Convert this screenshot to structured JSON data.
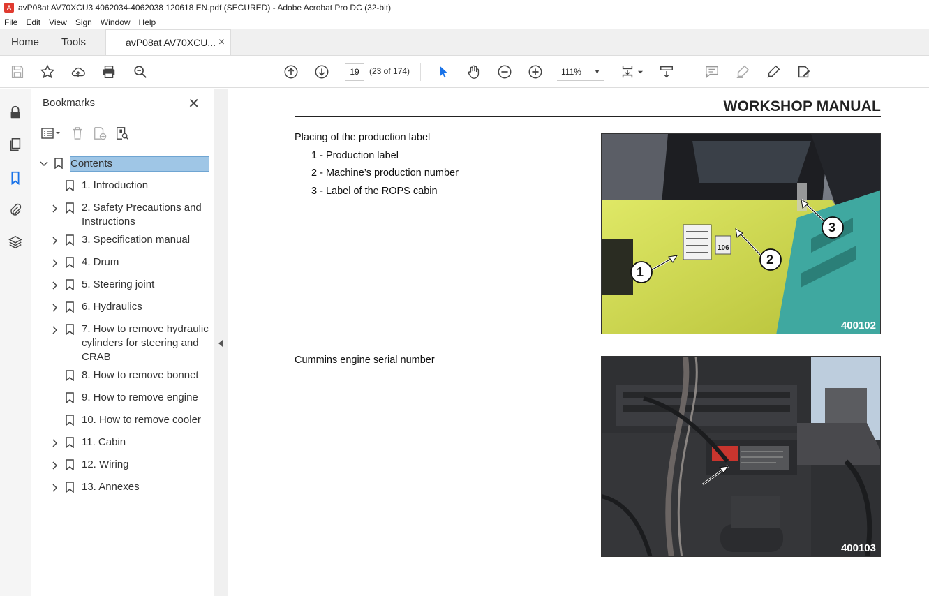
{
  "window": {
    "title": "avP08at AV70XCU3 4062034-4062038 120618 EN.pdf (SECURED) - Adobe Acrobat Pro DC (32-bit)"
  },
  "menu": [
    "File",
    "Edit",
    "View",
    "Sign",
    "Window",
    "Help"
  ],
  "tabs": {
    "home": "Home",
    "tools": "Tools",
    "document": "avP08at AV70XCU...",
    "close_glyph": "×"
  },
  "toolbar": {
    "page_number": "19",
    "page_count": "(23 of 174)",
    "zoom": "111%"
  },
  "bookmarks": {
    "title": "Bookmarks",
    "items": [
      {
        "label": "Contents",
        "expandable": true,
        "expanded": true,
        "selected": true
      },
      {
        "label": "1. Introduction",
        "expandable": false
      },
      {
        "label": "2. Safety Precautions and Instructions",
        "expandable": true
      },
      {
        "label": "3. Specification manual",
        "expandable": true
      },
      {
        "label": "4. Drum",
        "expandable": true
      },
      {
        "label": "5. Steering joint",
        "expandable": true
      },
      {
        "label": "6. Hydraulics",
        "expandable": true
      },
      {
        "label": "7. How to remove hydraulic cylinders for steering and CRAB",
        "expandable": true
      },
      {
        "label": "8. How to remove bonnet",
        "expandable": false
      },
      {
        "label": "9. How to remove engine",
        "expandable": false
      },
      {
        "label": "10. How to remove cooler",
        "expandable": false
      },
      {
        "label": "11. Cabin",
        "expandable": true
      },
      {
        "label": "12. Wiring",
        "expandable": true
      },
      {
        "label": "13. Annexes",
        "expandable": true
      }
    ]
  },
  "document": {
    "header": "WORKSHOP MANUAL",
    "section1": {
      "heading": "Placing of the production label",
      "items": [
        "1 - Production label",
        "2 - Machine’s production number",
        "3 - Label of the ROPS cabin"
      ],
      "photo_code": "400102",
      "callouts": [
        "1",
        "2",
        "3"
      ]
    },
    "section2": {
      "heading": "Cummins engine serial number",
      "photo_code": "400103"
    }
  },
  "colors": {
    "selection": "#9fc6e6",
    "machine_yellow": "#d6e04a",
    "machine_teal": "#3fa8a0"
  }
}
